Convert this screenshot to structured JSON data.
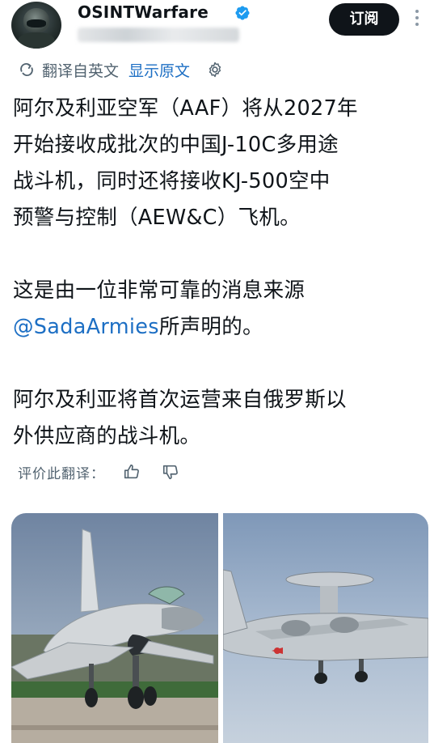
{
  "author": {
    "display_name": "OSINTWarfare",
    "avatar_icon": "pilot-helmet-avatar",
    "verified_icon": "verified-badge-icon",
    "verified_color": "#1d9bf0"
  },
  "header": {
    "subscribe_label": "订阅",
    "more_icon": "more-vertical-icon"
  },
  "translation": {
    "label": "翻译自英文",
    "show_original": "显示原文",
    "settings_icon": "gear-icon"
  },
  "tweet": {
    "paragraph1": [
      "阿尔及利亚空军（AAF）将从2027年",
      "开始接收成批次的中国J-10C多用途",
      "战斗机，同时还将接收KJ-500空中",
      "预警与控制（AEW&C）飞机。"
    ],
    "paragraph2_line1": "这是由一位非常可靠的消息来源",
    "mention": "@SadaArmies",
    "paragraph2_line2_rest": "所声明的。",
    "paragraph3": [
      "阿尔及利亚将首次运营来自俄罗斯以",
      "外供应商的战斗机。"
    ]
  },
  "rate_translation": {
    "label": "评价此翻译：",
    "thumb_up_icon": "thumb-up-icon",
    "thumb_down_icon": "thumb-down-icon"
  },
  "media": {
    "left_image": "j10c-fighter-photo",
    "right_image": "kj500-aewc-aircraft-photo"
  },
  "colors": {
    "link": "#1d6fc4",
    "text": "#0f1419",
    "secondary": "#536471",
    "button_bg": "#0f1419"
  }
}
